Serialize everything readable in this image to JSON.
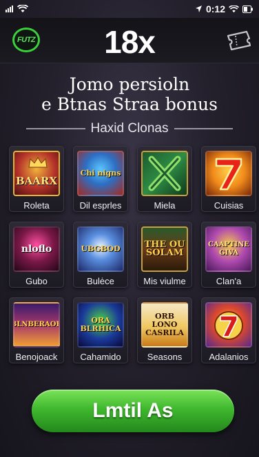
{
  "status_bar": {
    "time": "0:12"
  },
  "header": {
    "logo_text": "FUTZ",
    "multiplier": "18x",
    "right_icon": "ticket-icon"
  },
  "headline": {
    "line1": "Jomo persioln",
    "line2": "e Btnas Straa bonus"
  },
  "section": {
    "title": "Haxid Clonas"
  },
  "games": [
    {
      "label": "Roleta",
      "thumb_text": "BAARX",
      "accent": "#f0b33a"
    },
    {
      "label": "Dil esprles",
      "thumb_text": "Chi nigns",
      "accent": "#5cc6ff"
    },
    {
      "label": "Miela",
      "thumb_text": "",
      "accent": "#2e8c44"
    },
    {
      "label": "Cuisias",
      "thumb_text": "",
      "accent": "#ffd04a"
    },
    {
      "label": "Gubo",
      "thumb_text": "nloflo",
      "accent": "#ff4fa0"
    },
    {
      "label": "Bulėce",
      "thumb_text": "UBGBOD",
      "accent": "#5a8fe0"
    },
    {
      "label": "Mis viulme",
      "thumb_text": "THE OU SOLAM",
      "accent": "#6a3a18"
    },
    {
      "label": "Clan'a",
      "thumb_text": "CAAPTINE GIVA",
      "accent": "#b04ab0"
    },
    {
      "label": "Benojoack",
      "thumb_text": "BLNBERAOK",
      "accent": "#a83a6a"
    },
    {
      "label": "Cahamido",
      "thumb_text": "ORA BLRHICA",
      "accent": "#1a3a9a"
    },
    {
      "label": "Seasons",
      "thumb_text": "ORB LONO CASRILA",
      "accent": "#f0c860"
    },
    {
      "label": "Adalanios",
      "thumb_text": "",
      "accent": "#e04a2a"
    }
  ],
  "cta": {
    "label": "Lmtil As"
  },
  "colors": {
    "background": "#24212d",
    "cta_green": "#3fb82e",
    "logo_green": "#3ad13a"
  }
}
